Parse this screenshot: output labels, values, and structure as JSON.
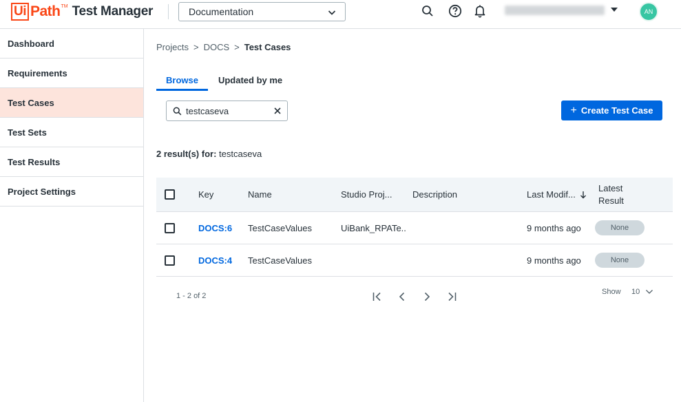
{
  "header": {
    "logo_ui": "Ui",
    "logo_path": "Path",
    "logo_tm": "TM",
    "product_name": "Test Manager",
    "project_selected": "Documentation",
    "avatar_initials": "AN"
  },
  "sidebar": {
    "items": [
      {
        "label": "Dashboard",
        "active": false
      },
      {
        "label": "Requirements",
        "active": false
      },
      {
        "label": "Test Cases",
        "active": true
      },
      {
        "label": "Test Sets",
        "active": false
      },
      {
        "label": "Test Results",
        "active": false
      },
      {
        "label": "Project Settings",
        "active": false
      }
    ]
  },
  "breadcrumb": {
    "items": [
      "Projects",
      "DOCS",
      "Test Cases"
    ],
    "separator": ">"
  },
  "tabs": [
    {
      "label": "Browse",
      "active": true
    },
    {
      "label": "Updated by me",
      "active": false
    }
  ],
  "search": {
    "value": "testcaseva"
  },
  "create_button": {
    "label": "Create Test Case"
  },
  "results_summary": {
    "prefix": "2 result(s) for:",
    "query": "testcaseva"
  },
  "table": {
    "columns": [
      "Key",
      "Name",
      "Studio Proj...",
      "Description",
      "Last Modif...",
      "Latest",
      "Result"
    ],
    "rows": [
      {
        "key": "DOCS:6",
        "name": "TestCaseValues",
        "studio_project": "UiBank_RPATe...",
        "description": "",
        "last_modified": "9 months ago",
        "latest_result": "None"
      },
      {
        "key": "DOCS:4",
        "name": "TestCaseValues",
        "studio_project": "",
        "description": "",
        "last_modified": "9 months ago",
        "latest_result": "None"
      }
    ]
  },
  "pagination": {
    "range": "1 - 2 of 2",
    "show_label": "Show",
    "page_size": "10"
  },
  "colors": {
    "brand_orange": "#fa4616",
    "primary_blue": "#0067df",
    "active_nav_bg": "#fde4dc",
    "avatar_bg": "#38c6a3"
  }
}
